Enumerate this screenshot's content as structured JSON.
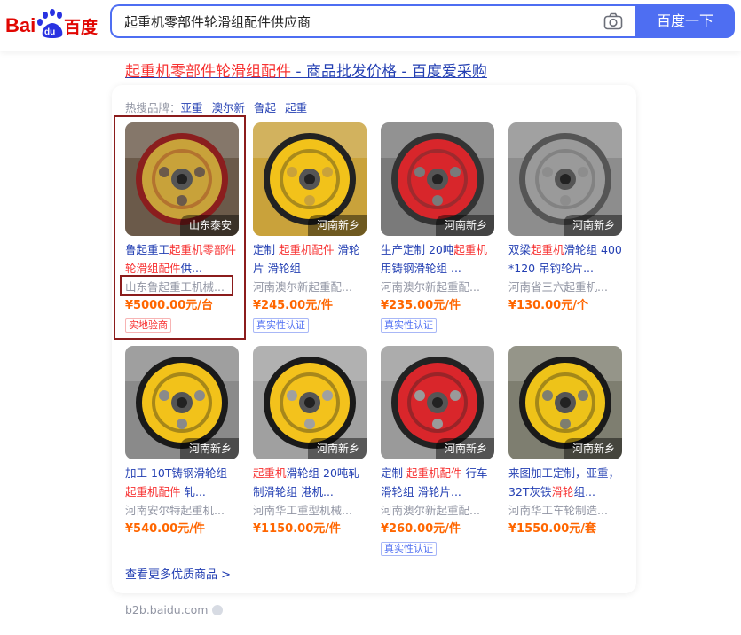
{
  "search": {
    "query": "起重机零部件轮滑组配件供应商",
    "button_label": "百度一下"
  },
  "logo": {
    "text_bai": "Bai",
    "text_du": "du",
    "text_cn": "百度"
  },
  "result": {
    "title_highlight": "起重机零部件轮滑组配件",
    "title_rest": " - 商品批发价格 - 百度爱采购"
  },
  "hot_brands": {
    "label": "热搜品牌：",
    "items": [
      "亚重",
      "澳尔新",
      "鲁起",
      "起重"
    ]
  },
  "products": [
    {
      "location": "山东泰安",
      "name_parts": [
        [
          "鲁起重工",
          false
        ],
        [
          "起重机零部件轮滑组配件",
          true
        ],
        [
          "供...",
          false
        ]
      ],
      "company": "山东鲁起重工机械...",
      "price": "¥5000.00元/台",
      "tag": "实地验商",
      "tag_color": "red"
    },
    {
      "location": "河南新乡",
      "name_parts": [
        [
          "定制 ",
          false
        ],
        [
          "起重机配件",
          true
        ],
        [
          " 滑轮片 滑轮组",
          false
        ]
      ],
      "company": "河南澳尔新起重配...",
      "price": "¥245.00元/件",
      "tag": "真实性认证",
      "tag_color": "blue"
    },
    {
      "location": "河南新乡",
      "name_parts": [
        [
          "生产定制 20吨",
          false
        ],
        [
          "起重机",
          true
        ],
        [
          "用铸钢滑轮组 ...",
          false
        ]
      ],
      "company": "河南澳尔新起重配...",
      "price": "¥235.00元/件",
      "tag": "真实性认证",
      "tag_color": "blue"
    },
    {
      "location": "河南新乡",
      "name_parts": [
        [
          "双梁",
          false
        ],
        [
          "起重机",
          true
        ],
        [
          "滑轮组 400*120 吊钩轮片...",
          false
        ]
      ],
      "company": "河南省三六起重机...",
      "price": "¥130.00元/个",
      "tag": "",
      "tag_color": ""
    },
    {
      "location": "河南新乡",
      "name_parts": [
        [
          "加工 10T铸钢滑轮组 ",
          false
        ],
        [
          "起重机配件",
          true
        ],
        [
          " 轧...",
          false
        ]
      ],
      "company": "河南安尔特起重机...",
      "price": "¥540.00元/件",
      "tag": "",
      "tag_color": ""
    },
    {
      "location": "河南新乡",
      "name_parts": [
        [
          "起重机",
          true
        ],
        [
          "滑轮组 20吨轧制滑轮组 港机...",
          false
        ]
      ],
      "company": "河南华工重型机械...",
      "price": "¥1150.00元/件",
      "tag": "",
      "tag_color": ""
    },
    {
      "location": "河南新乡",
      "name_parts": [
        [
          "定制 ",
          false
        ],
        [
          "起重机配件",
          true
        ],
        [
          " 行车滑轮组 滑轮片...",
          false
        ]
      ],
      "company": "河南澳尔新起重配...",
      "price": "¥260.00元/件",
      "tag": "真实性认证",
      "tag_color": "blue"
    },
    {
      "location": "河南新乡",
      "name_parts": [
        [
          "来图加工定制，亚重，32T灰铁",
          false
        ],
        [
          "滑轮",
          true
        ],
        [
          "组...",
          false
        ]
      ],
      "company": "河南华工车轮制造...",
      "price": "¥1550.00元/套",
      "tag": "",
      "tag_color": ""
    }
  ],
  "more_link": "查看更多优质商品 >",
  "source": "b2b.baidu.com",
  "colors": {
    "accent": "#4e6ef2",
    "highlight": "#f73131",
    "price": "#ff6600",
    "link": "#2440b3"
  }
}
